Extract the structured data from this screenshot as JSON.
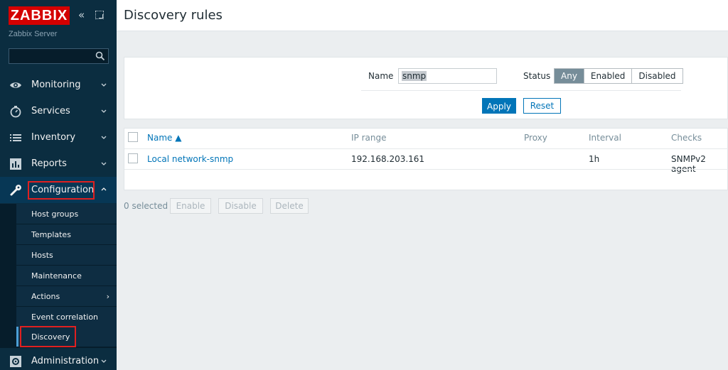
{
  "sidebar": {
    "brand": "ZABBIX",
    "server_name": "Zabbix Server",
    "search": {
      "value": "",
      "placeholder": ""
    },
    "menu": [
      {
        "label": "Monitoring",
        "icon": "eye-icon"
      },
      {
        "label": "Services",
        "icon": "stopwatch-icon"
      },
      {
        "label": "Inventory",
        "icon": "list-icon"
      },
      {
        "label": "Reports",
        "icon": "bar-chart-icon"
      },
      {
        "label": "Configuration",
        "icon": "wrench-icon",
        "expanded": true
      },
      {
        "label": "Administration",
        "icon": "gear-icon"
      }
    ],
    "submenu": [
      {
        "label": "Host groups"
      },
      {
        "label": "Templates"
      },
      {
        "label": "Hosts"
      },
      {
        "label": "Maintenance"
      },
      {
        "label": "Actions",
        "has_children": true,
        "chevron": "›"
      },
      {
        "label": "Event correlation"
      },
      {
        "label": "Discovery",
        "current": true
      }
    ]
  },
  "header": {
    "title": "Discovery rules"
  },
  "filter": {
    "name_label": "Name",
    "name_value": "snmp",
    "status_label": "Status",
    "status_options": [
      "Any",
      "Enabled",
      "Disabled"
    ],
    "status_selected": "Any",
    "apply_label": "Apply",
    "reset_label": "Reset"
  },
  "table": {
    "columns": [
      "Name ▲",
      "IP range",
      "Proxy",
      "Interval",
      "Checks"
    ],
    "sorted_column": "Name",
    "rows": [
      {
        "name": "Local network-snmp",
        "ip_range": "192.168.203.161",
        "proxy": "",
        "interval": "1h",
        "checks": "SNMPv2 agent"
      }
    ]
  },
  "footer": {
    "selected_text": "0 selected",
    "buttons": [
      "Enable",
      "Disable",
      "Delete"
    ]
  },
  "colors": {
    "sidebar_bg": "#0b2d40",
    "brand_red": "#d40000",
    "accent_blue": "#0275b8",
    "highlight_red": "#e02020"
  }
}
